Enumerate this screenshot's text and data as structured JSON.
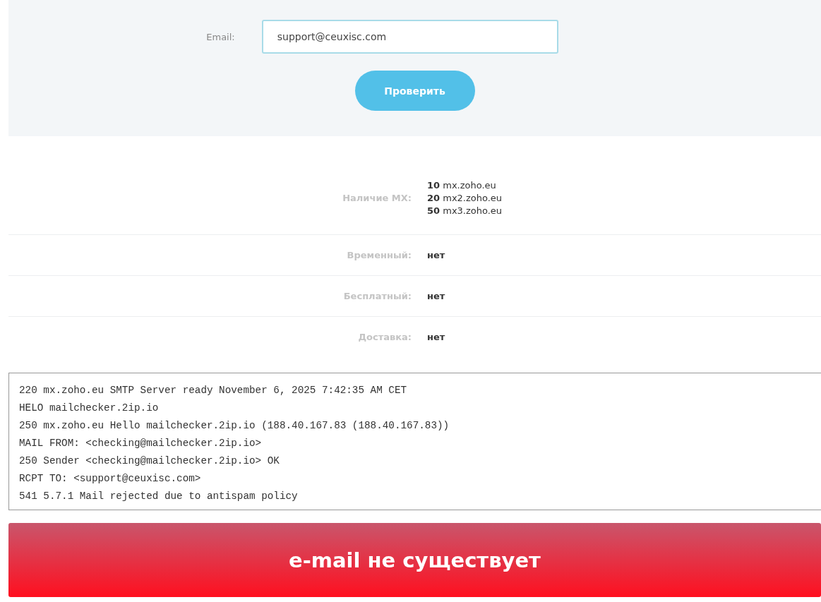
{
  "form": {
    "label": "Email:",
    "value": "support@ceuxisc.com",
    "button": "Проверить"
  },
  "results": [
    {
      "label": "Наличие MX:",
      "kind": "mx",
      "records": [
        {
          "priority": "10",
          "host": "mx.zoho.eu"
        },
        {
          "priority": "20",
          "host": "mx2.zoho.eu"
        },
        {
          "priority": "50",
          "host": "mx3.zoho.eu"
        }
      ]
    },
    {
      "label": "Временный:",
      "kind": "text",
      "value": "нет"
    },
    {
      "label": "Бесплатный:",
      "kind": "text",
      "value": "нет"
    },
    {
      "label": "Доставка:",
      "kind": "text",
      "value": "нет"
    }
  ],
  "log": [
    "220 mx.zoho.eu SMTP Server ready November 6, 2025 7:42:35 AM CET",
    "HELO mailchecker.2ip.io",
    "250 mx.zoho.eu Hello mailchecker.2ip.io (188.40.167.83 (188.40.167.83))",
    "MAIL FROM: <checking@mailchecker.2ip.io>",
    "250 Sender <checking@mailchecker.2ip.io> OK",
    "RCPT TO: <support@ceuxisc.com>",
    "541 5.7.1 Mail rejected due to antispam policy"
  ],
  "verdict": {
    "text": "e-mail не существует"
  }
}
